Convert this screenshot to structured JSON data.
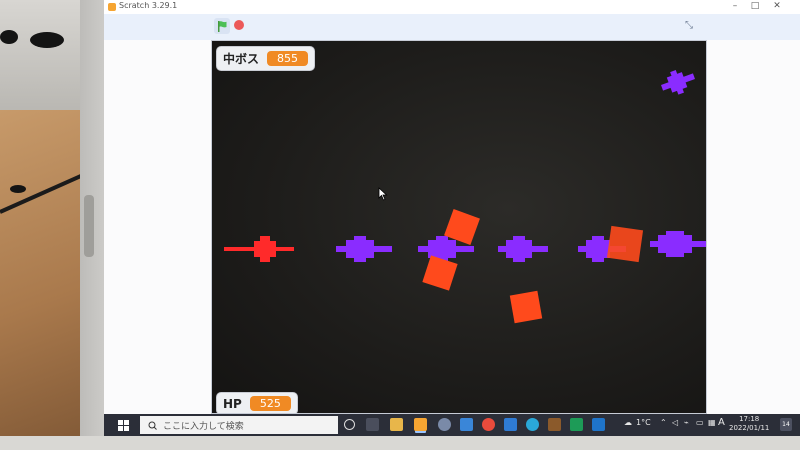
{
  "window": {
    "title": "Scratch 3.29.1",
    "minimize": "–",
    "maximize": "□",
    "close": "✕"
  },
  "toolbar": {
    "green_flag": "green-flag-icon",
    "stop": "stop-icon",
    "fullscreen_glyph": "⤡"
  },
  "stage": {
    "boss_monitor": {
      "label": "中ボス",
      "value": "855"
    },
    "hp_monitor": {
      "label": "HP",
      "value": "525"
    }
  },
  "taskbar": {
    "search_placeholder": "ここに入力して検索",
    "weather": "1°C",
    "ime": "A",
    "time": "17:18",
    "date": "2022/01/11",
    "notifications": "14"
  },
  "colors": {
    "player": "#ff2a2a",
    "enemy": "#8a2cff",
    "block": "#ff4a1c",
    "accent": "#f08a24"
  }
}
